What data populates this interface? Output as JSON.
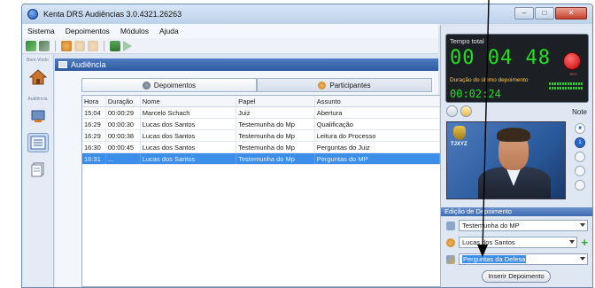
{
  "window": {
    "title": "Kenta DRS Audiências 3.0.4321.26263",
    "controls": {
      "minimize": "–",
      "maximize": "□",
      "close": "✕"
    }
  },
  "menu": [
    "Sistema",
    "Depoimentos",
    "Módulos",
    "Ajuda"
  ],
  "sidebar": {
    "labels": [
      "Bem-Vindo",
      "Audiência"
    ]
  },
  "section": {
    "title": "Audiência"
  },
  "tabs": [
    {
      "label": "Depoimentos",
      "icon": "microphone-icon",
      "active": true
    },
    {
      "label": "Participantes",
      "icon": "people-icon",
      "active": false
    }
  ],
  "table": {
    "columns": [
      "Hora",
      "Duração",
      "Nome",
      "Papel",
      "Assunto"
    ],
    "rows": [
      [
        "15:04",
        "00:00:29",
        "Marcelo Schach",
        "Juiz",
        "Abertura"
      ],
      [
        "16:29",
        "00:00:30",
        "Lucas dos Santos",
        "Testemunha do Mp",
        "Qualificação"
      ],
      [
        "16:29",
        "00:00:38",
        "Lucas dos Santos",
        "Testemunha do Mp",
        "Leitura do Processo"
      ],
      [
        "16:30",
        "00:00:45",
        "Lucas dos Santos",
        "Testemunha do Mp",
        "Perguntas do Juiz"
      ],
      [
        "16:31",
        "...",
        "Lucas dos Santos",
        "Testemunha do Mp",
        "Perguntas do MP"
      ]
    ],
    "selected_row": 4
  },
  "recorder": {
    "total_label": "Tempo total",
    "total_time": "00 04 48",
    "last_label": "Duração do último depoimento",
    "last_time": "00:02:24",
    "rec_label": "REC",
    "note_label": "Note"
  },
  "video": {
    "tag": "TJXYZ"
  },
  "page_dots": [
    "",
    "1",
    "",
    "",
    ""
  ],
  "edicao": {
    "title": "Edição de Depoimento",
    "papel": "Testemunha do MP",
    "nome": "Lucas dos Santos",
    "assunto": "Perguntas da Defesa",
    "insert_button": "Inserir Depoimento"
  },
  "colors": {
    "accent": "#3d8ee8",
    "timer_green": "#20e020",
    "rec_red": "#c00000"
  }
}
